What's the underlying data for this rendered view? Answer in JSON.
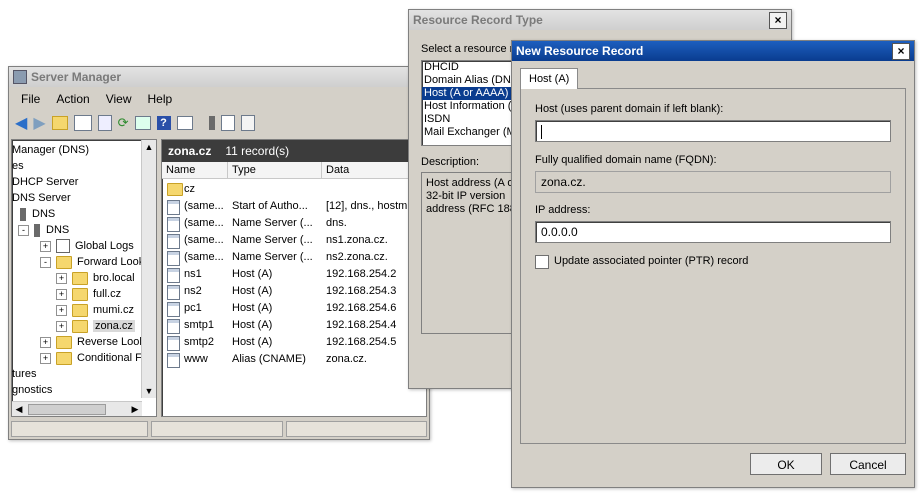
{
  "server_manager": {
    "title": "Server Manager",
    "menu": [
      "File",
      "Action",
      "View",
      "Help"
    ],
    "tree": [
      {
        "label": "Manager (DNS)"
      },
      {
        "label": "es"
      },
      {
        "label": "DHCP Server"
      },
      {
        "label": "DNS Server"
      },
      {
        "label": "DNS"
      },
      {
        "label": "DNS"
      },
      {
        "label": "Global Logs"
      },
      {
        "label": "Forward Looku"
      },
      {
        "label": "bro.local"
      },
      {
        "label": "full.cz"
      },
      {
        "label": "mumi.cz"
      },
      {
        "label": "zona.cz"
      },
      {
        "label": "Reverse Looku"
      },
      {
        "label": "Conditional Fo"
      },
      {
        "label": "tures"
      },
      {
        "label": "gnostics"
      }
    ],
    "zone_header": {
      "name": "zona.cz",
      "count": "11 record(s)"
    },
    "columns": [
      "Name",
      "Type",
      "Data"
    ],
    "records": [
      {
        "name": "cz",
        "type": "",
        "data": "",
        "icon": "folder"
      },
      {
        "name": "(same...",
        "type": "Start of Autho...",
        "data": "[12], dns., hostm",
        "icon": "doc"
      },
      {
        "name": "(same...",
        "type": "Name Server (...",
        "data": "dns.",
        "icon": "doc"
      },
      {
        "name": "(same...",
        "type": "Name Server (...",
        "data": "ns1.zona.cz.",
        "icon": "doc"
      },
      {
        "name": "(same...",
        "type": "Name Server (...",
        "data": "ns2.zona.cz.",
        "icon": "doc"
      },
      {
        "name": "ns1",
        "type": "Host (A)",
        "data": "192.168.254.2",
        "icon": "doc"
      },
      {
        "name": "ns2",
        "type": "Host (A)",
        "data": "192.168.254.3",
        "icon": "doc"
      },
      {
        "name": "pc1",
        "type": "Host (A)",
        "data": "192.168.254.6",
        "icon": "doc"
      },
      {
        "name": "smtp1",
        "type": "Host (A)",
        "data": "192.168.254.4",
        "icon": "doc"
      },
      {
        "name": "smtp2",
        "type": "Host (A)",
        "data": "192.168.254.5",
        "icon": "doc"
      },
      {
        "name": "www",
        "type": "Alias (CNAME)",
        "data": "zona.cz.",
        "icon": "doc"
      }
    ]
  },
  "rr_type": {
    "title": "Resource Record Type",
    "select_label": "Select a resource r",
    "list": [
      "DHCID",
      "Domain Alias (DNA",
      "Host (A or AAAA)",
      "Host Information (",
      "ISDN",
      "Mail Exchanger (M"
    ],
    "selected_index": 2,
    "description_label": "Description:",
    "description": [
      "Host address (A o",
      "32-bit IP version",
      "address (RFC 188"
    ]
  },
  "new_rr": {
    "title": "New Resource Record",
    "tab": "Host (A)",
    "host_label": "Host (uses parent domain if left blank):",
    "host_value": "",
    "fqdn_label": "Fully qualified domain name (FQDN):",
    "fqdn_value": "zona.cz.",
    "ip_label": "IP address:",
    "ip_value": "0.0.0.0",
    "ptr_label": "Update associated pointer (PTR) record",
    "ok": "OK",
    "cancel": "Cancel"
  }
}
